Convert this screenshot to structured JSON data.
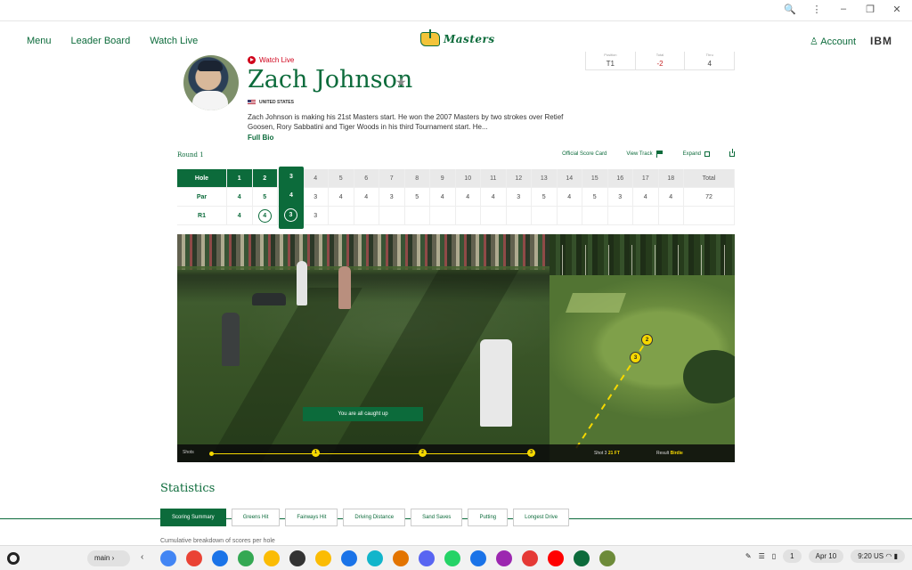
{
  "browser": {
    "controls": [
      "🔍",
      "⋮",
      "–",
      "❐",
      "✕"
    ]
  },
  "nav": {
    "menu": "Menu",
    "leader_board": "Leader Board",
    "watch_live": "Watch Live",
    "logo_text": "Masters",
    "account": "Account",
    "sponsor": "IBM"
  },
  "player": {
    "watch_live": "Watch Live",
    "name": "Zach Johnson",
    "country": "UNITED STATES",
    "bio": "Zach Johnson is making his 21st Masters start. He won the 2007 Masters by two strokes over Retief Goosen, Rory Sabbatini and Tiger Woods in his third Tournament start. He...",
    "full_bio": "Full Bio",
    "stats": [
      {
        "label": "Position",
        "value": "T1"
      },
      {
        "label": "Total",
        "value": "-2"
      },
      {
        "label": "Thru",
        "value": "4"
      }
    ]
  },
  "round": {
    "label": "Round 1",
    "links": {
      "score_card": "Official Score Card",
      "view_track": "View Track",
      "expand": "Expand"
    }
  },
  "scorecard": {
    "hole_label": "Hole",
    "par_label": "Par",
    "r1_label": "R1",
    "total_label": "Total",
    "holes": [
      "1",
      "2",
      "3",
      "4",
      "5",
      "6",
      "7",
      "8",
      "9",
      "10",
      "11",
      "12",
      "13",
      "14",
      "15",
      "16",
      "17",
      "18"
    ],
    "par": [
      "4",
      "5",
      "4",
      "3",
      "4",
      "4",
      "3",
      "5",
      "4",
      "4",
      "4",
      "3",
      "5",
      "4",
      "5",
      "3",
      "4",
      "4"
    ],
    "par_total": "72",
    "r1": [
      "4",
      "4",
      "3",
      "3",
      "",
      "",
      "",
      "",
      "",
      "",
      "",
      "",
      "",
      "",
      "",
      "",
      "",
      ""
    ],
    "r1_total": "",
    "current_hole": "3",
    "current_par": "4",
    "current_score": "3"
  },
  "video": {
    "caught_up": "You are all caught up",
    "shots_label": "Shots",
    "shot_markers": [
      "1",
      "2",
      "3"
    ]
  },
  "track": {
    "shot_label": "Shot 3",
    "shot_distance": "21 FT",
    "result_label": "Result",
    "result_value": "Birdie",
    "pins": [
      "2",
      "3"
    ]
  },
  "statistics": {
    "title": "Statistics",
    "tabs": [
      "Scoring Summary",
      "Greens Hit",
      "Fairways Hit",
      "Driving Distance",
      "Sand Saves",
      "Putting",
      "Longest Drive"
    ],
    "active_tab": "Scoring Summary",
    "caption": "Cumulative breakdown of scores per hole"
  },
  "shelf": {
    "desk_label": "main",
    "date": "Apr 10",
    "time": "9:20",
    "locale": "US",
    "notification_count": "1",
    "app_colors": [
      "#4285f4",
      "#ea4335",
      "#1a73e8",
      "#34a853",
      "#fbbc04",
      "#333333",
      "#fbbc04",
      "#1a73e8",
      "#12b5cb",
      "#e37400",
      "#5865f2",
      "#25d366",
      "#1a73e8",
      "#9c27b0",
      "#e53935",
      "#ff0000",
      "#0c6b3b",
      "#6d8b3a"
    ]
  }
}
